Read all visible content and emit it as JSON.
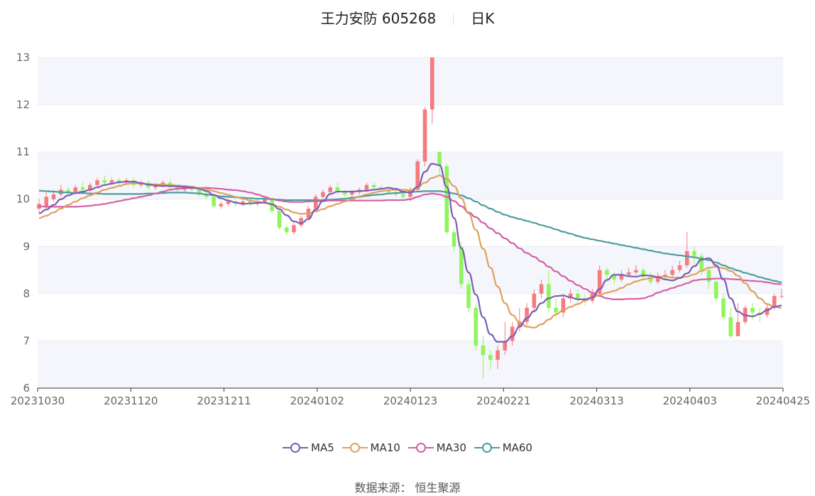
{
  "header": {
    "name": "王力安防 605268",
    "period": "日K"
  },
  "source_text": "数据来源： 恒生聚源",
  "colors": {
    "up": "#f47b7f",
    "down": "#8ef55b",
    "MA5": "#7b5fb3",
    "MA10": "#e0a060",
    "MA30": "#d35faa",
    "MA60": "#4d9c9c",
    "grid": "#e8ecf4",
    "band": "#f4f6fb"
  },
  "chart_data": {
    "type": "candlestick",
    "y_ticks": [
      6,
      7,
      8,
      9,
      10,
      11,
      12,
      13
    ],
    "ylim": [
      6,
      13
    ],
    "x_ticks": [
      "20231030",
      "20231120",
      "20231211",
      "20240102",
      "20240123",
      "20240221",
      "20240313",
      "20240403",
      "20240425"
    ],
    "legend": [
      "MA5",
      "MA10",
      "MA30",
      "MA60"
    ],
    "candles": [
      [
        9.8,
        9.9,
        10.0,
        9.7
      ],
      [
        9.85,
        10.05,
        10.15,
        9.8
      ],
      [
        10.0,
        10.1,
        10.2,
        9.95
      ],
      [
        10.1,
        10.2,
        10.3,
        10.05
      ],
      [
        10.2,
        10.15,
        10.25,
        10.05
      ],
      [
        10.15,
        10.25,
        10.3,
        10.1
      ],
      [
        10.25,
        10.2,
        10.35,
        10.15
      ],
      [
        10.2,
        10.3,
        10.35,
        10.15
      ],
      [
        10.3,
        10.4,
        10.45,
        10.25
      ],
      [
        10.4,
        10.35,
        10.5,
        10.3
      ],
      [
        10.35,
        10.4,
        10.45,
        10.3
      ],
      [
        10.4,
        10.35,
        10.45,
        10.3
      ],
      [
        10.35,
        10.4,
        10.45,
        10.3
      ],
      [
        10.4,
        10.3,
        10.45,
        10.25
      ],
      [
        10.3,
        10.35,
        10.4,
        10.25
      ],
      [
        10.35,
        10.25,
        10.4,
        10.2
      ],
      [
        10.25,
        10.3,
        10.35,
        10.2
      ],
      [
        10.3,
        10.35,
        10.4,
        10.25
      ],
      [
        10.35,
        10.25,
        10.4,
        10.2
      ],
      [
        10.25,
        10.2,
        10.3,
        10.15
      ],
      [
        10.2,
        10.25,
        10.3,
        10.15
      ],
      [
        10.25,
        10.2,
        10.3,
        10.15
      ],
      [
        10.2,
        10.1,
        10.25,
        10.05
      ],
      [
        10.1,
        10.05,
        10.2,
        10.0
      ],
      [
        10.05,
        9.85,
        10.1,
        9.8
      ],
      [
        9.85,
        9.9,
        9.95,
        9.8
      ],
      [
        9.9,
        9.95,
        10.0,
        9.85
      ],
      [
        9.95,
        9.9,
        10.0,
        9.85
      ],
      [
        9.9,
        9.95,
        10.0,
        9.85
      ],
      [
        9.95,
        9.9,
        10.0,
        9.85
      ],
      [
        9.9,
        9.95,
        10.0,
        9.85
      ],
      [
        9.95,
        10.0,
        10.05,
        9.9
      ],
      [
        10.0,
        9.75,
        10.05,
        9.7
      ],
      [
        9.75,
        9.4,
        9.8,
        9.35
      ],
      [
        9.4,
        9.3,
        9.45,
        9.25
      ],
      [
        9.3,
        9.45,
        9.5,
        9.25
      ],
      [
        9.45,
        9.6,
        9.65,
        9.4
      ],
      [
        9.6,
        9.8,
        9.85,
        9.55
      ],
      [
        9.8,
        10.05,
        10.1,
        9.75
      ],
      [
        10.05,
        10.15,
        10.2,
        10.0
      ],
      [
        10.15,
        10.25,
        10.3,
        10.1
      ],
      [
        10.25,
        10.15,
        10.35,
        10.1
      ],
      [
        10.15,
        10.1,
        10.2,
        10.05
      ],
      [
        10.1,
        10.15,
        10.2,
        10.05
      ],
      [
        10.15,
        10.2,
        10.25,
        10.1
      ],
      [
        10.2,
        10.3,
        10.35,
        10.15
      ],
      [
        10.3,
        10.25,
        10.35,
        10.2
      ],
      [
        10.25,
        10.2,
        10.3,
        10.15
      ],
      [
        10.2,
        10.15,
        10.25,
        10.1
      ],
      [
        10.15,
        10.1,
        10.2,
        10.05
      ],
      [
        10.1,
        10.05,
        10.15,
        10.0
      ],
      [
        10.05,
        10.2,
        10.25,
        9.95
      ],
      [
        10.2,
        10.8,
        10.85,
        10.15
      ],
      [
        10.8,
        11.9,
        11.95,
        10.7
      ],
      [
        11.9,
        13.0,
        13.0,
        11.6
      ],
      [
        11.0,
        10.7,
        10.85,
        10.5
      ],
      [
        10.7,
        9.3,
        10.75,
        9.25
      ],
      [
        9.3,
        9.0,
        9.35,
        8.9
      ],
      [
        9.0,
        8.2,
        9.1,
        8.1
      ],
      [
        8.2,
        7.7,
        8.3,
        7.6
      ],
      [
        7.7,
        6.9,
        7.8,
        6.8
      ],
      [
        6.9,
        6.7,
        7.1,
        6.2
      ],
      [
        6.7,
        6.6,
        6.8,
        6.4
      ],
      [
        6.6,
        6.8,
        6.9,
        6.4
      ],
      [
        6.8,
        7.0,
        7.4,
        6.7
      ],
      [
        7.0,
        7.3,
        7.4,
        6.9
      ],
      [
        7.3,
        7.4,
        7.7,
        7.2
      ],
      [
        7.4,
        7.7,
        7.8,
        7.3
      ],
      [
        7.7,
        8.0,
        8.1,
        7.6
      ],
      [
        8.0,
        8.2,
        8.3,
        7.9
      ],
      [
        8.2,
        7.7,
        8.5,
        7.6
      ],
      [
        7.7,
        7.6,
        7.9,
        7.5
      ],
      [
        7.6,
        7.9,
        8.0,
        7.5
      ],
      [
        7.9,
        8.0,
        8.1,
        7.8
      ],
      [
        8.0,
        7.9,
        8.1,
        7.8
      ],
      [
        7.9,
        7.85,
        8.0,
        7.75
      ],
      [
        7.85,
        8.0,
        8.1,
        7.8
      ],
      [
        8.0,
        8.5,
        8.6,
        7.95
      ],
      [
        8.5,
        8.4,
        8.55,
        8.25
      ],
      [
        8.4,
        8.3,
        8.45,
        8.2
      ],
      [
        8.3,
        8.4,
        8.5,
        8.25
      ],
      [
        8.4,
        8.45,
        8.55,
        8.35
      ],
      [
        8.45,
        8.5,
        8.6,
        8.4
      ],
      [
        8.5,
        8.35,
        8.55,
        8.3
      ],
      [
        8.35,
        8.25,
        8.45,
        8.2
      ],
      [
        8.25,
        8.35,
        8.45,
        8.2
      ],
      [
        8.35,
        8.4,
        8.5,
        8.3
      ],
      [
        8.4,
        8.5,
        8.6,
        8.35
      ],
      [
        8.5,
        8.6,
        8.7,
        8.45
      ],
      [
        8.6,
        8.9,
        9.3,
        8.55
      ],
      [
        8.9,
        8.8,
        9.0,
        8.6
      ],
      [
        8.8,
        8.5,
        8.85,
        8.4
      ],
      [
        8.5,
        8.25,
        8.55,
        8.1
      ],
      [
        8.25,
        7.9,
        8.3,
        7.85
      ],
      [
        7.9,
        7.5,
        8.0,
        7.45
      ],
      [
        7.5,
        7.1,
        7.7,
        7.05
      ],
      [
        7.1,
        7.4,
        7.8,
        7.15
      ],
      [
        7.4,
        7.7,
        7.75,
        7.35
      ],
      [
        7.7,
        7.6,
        7.8,
        7.45
      ],
      [
        7.6,
        7.55,
        7.7,
        7.4
      ],
      [
        7.55,
        7.7,
        7.8,
        7.5
      ],
      [
        7.7,
        7.95,
        8.0,
        7.65
      ],
      [
        7.95,
        7.95,
        8.1,
        7.9
      ]
    ],
    "ma": {
      "MA5": [
        9.7,
        9.78,
        9.88,
        10.0,
        10.08,
        10.13,
        10.16,
        10.2,
        10.25,
        10.3,
        10.33,
        10.36,
        10.37,
        10.37,
        10.34,
        10.31,
        10.29,
        10.28,
        10.28,
        10.27,
        10.26,
        10.25,
        10.22,
        10.17,
        10.09,
        10.02,
        9.97,
        9.93,
        9.9,
        9.91,
        9.92,
        9.93,
        9.89,
        9.79,
        9.66,
        9.53,
        9.49,
        9.58,
        9.78,
        9.96,
        10.11,
        10.16,
        10.16,
        10.16,
        10.17,
        10.18,
        10.2,
        10.22,
        10.24,
        10.22,
        10.16,
        10.14,
        10.26,
        10.58,
        10.75,
        10.72,
        10.26,
        9.6,
        8.96,
        8.45,
        7.98,
        7.5,
        7.14,
        6.98,
        6.98,
        7.1,
        7.3,
        7.48,
        7.63,
        7.8,
        7.9,
        7.95,
        7.96,
        7.92,
        7.88,
        7.88,
        7.92,
        8.1,
        8.29,
        8.4,
        8.4,
        8.37,
        8.36,
        8.39,
        8.38,
        8.35,
        8.3,
        8.28,
        8.33,
        8.43,
        8.58,
        8.72,
        8.75,
        8.6,
        8.3,
        7.9,
        7.62,
        7.54,
        7.52,
        7.57,
        7.65,
        7.72,
        7.75
      ],
      "MA10": [
        9.6,
        9.65,
        9.72,
        9.8,
        9.88,
        9.95,
        10.02,
        10.08,
        10.14,
        10.2,
        10.24,
        10.28,
        10.32,
        10.34,
        10.33,
        10.32,
        10.31,
        10.31,
        10.3,
        10.29,
        10.28,
        10.26,
        10.24,
        10.21,
        10.17,
        10.13,
        10.09,
        10.05,
        10.01,
        9.97,
        9.95,
        9.92,
        9.89,
        9.84,
        9.78,
        9.72,
        9.69,
        9.7,
        9.74,
        9.79,
        9.85,
        9.9,
        9.95,
        10.0,
        10.06,
        10.1,
        10.14,
        10.17,
        10.19,
        10.2,
        10.2,
        10.19,
        10.25,
        10.35,
        10.45,
        10.5,
        10.43,
        10.28,
        10.02,
        9.7,
        9.35,
        8.95,
        8.55,
        8.15,
        7.8,
        7.55,
        7.4,
        7.3,
        7.28,
        7.35,
        7.45,
        7.56,
        7.65,
        7.72,
        7.78,
        7.85,
        7.92,
        7.97,
        8.02,
        8.06,
        8.12,
        8.2,
        8.26,
        8.3,
        8.33,
        8.36,
        8.36,
        8.34,
        8.34,
        8.36,
        8.41,
        8.48,
        8.55,
        8.57,
        8.54,
        8.48,
        8.38,
        8.22,
        8.05,
        7.9,
        7.78,
        7.72,
        7.7
      ],
      "MA30": [
        9.85,
        9.84,
        9.84,
        9.84,
        9.84,
        9.84,
        9.85,
        9.86,
        9.88,
        9.9,
        9.93,
        9.96,
        9.99,
        10.02,
        10.05,
        10.08,
        10.12,
        10.16,
        10.2,
        10.22,
        10.23,
        10.24,
        10.24,
        10.24,
        10.23,
        10.22,
        10.2,
        10.19,
        10.17,
        10.14,
        10.1,
        10.05,
        10.0,
        9.97,
        9.95,
        9.94,
        9.94,
        9.95,
        9.96,
        9.96,
        9.97,
        9.97,
        9.97,
        9.97,
        9.97,
        9.97,
        9.97,
        9.97,
        9.98,
        9.98,
        9.98,
        10.0,
        10.05,
        10.1,
        10.12,
        10.1,
        10.05,
        9.96,
        9.85,
        9.72,
        9.62,
        9.5,
        9.38,
        9.28,
        9.17,
        9.07,
        8.96,
        8.86,
        8.78,
        8.68,
        8.57,
        8.47,
        8.37,
        8.27,
        8.18,
        8.1,
        8.02,
        7.95,
        7.9,
        7.88,
        7.88,
        7.89,
        7.89,
        7.9,
        7.95,
        8.02,
        8.07,
        8.12,
        8.17,
        8.22,
        8.28,
        8.3,
        8.31,
        8.32,
        8.32,
        8.31,
        8.3,
        8.28,
        8.27,
        8.26,
        8.24,
        8.21,
        8.2
      ],
      "MA60": [
        10.18,
        10.17,
        10.16,
        10.15,
        10.14,
        10.13,
        10.13,
        10.12,
        10.12,
        10.11,
        10.11,
        10.11,
        10.11,
        10.11,
        10.11,
        10.12,
        10.12,
        10.13,
        10.14,
        10.14,
        10.14,
        10.13,
        10.12,
        10.1,
        10.08,
        10.06,
        10.05,
        10.04,
        10.03,
        10.02,
        10.01,
        10.01,
        10.0,
        9.99,
        9.98,
        9.98,
        9.98,
        9.98,
        9.98,
        9.98,
        9.99,
        10.0,
        10.01,
        10.03,
        10.05,
        10.07,
        10.09,
        10.1,
        10.12,
        10.13,
        10.14,
        10.15,
        10.16,
        10.17,
        10.17,
        10.17,
        10.15,
        10.12,
        10.08,
        10.02,
        9.95,
        9.87,
        9.8,
        9.73,
        9.67,
        9.62,
        9.58,
        9.54,
        9.5,
        9.45,
        9.41,
        9.36,
        9.31,
        9.27,
        9.22,
        9.18,
        9.15,
        9.12,
        9.09,
        9.06,
        9.03,
        9.0,
        8.97,
        8.94,
        8.91,
        8.88,
        8.85,
        8.83,
        8.81,
        8.79,
        8.77,
        8.74,
        8.71,
        8.66,
        8.6,
        8.54,
        8.49,
        8.44,
        8.4,
        8.35,
        8.31,
        8.27,
        8.24
      ]
    }
  }
}
